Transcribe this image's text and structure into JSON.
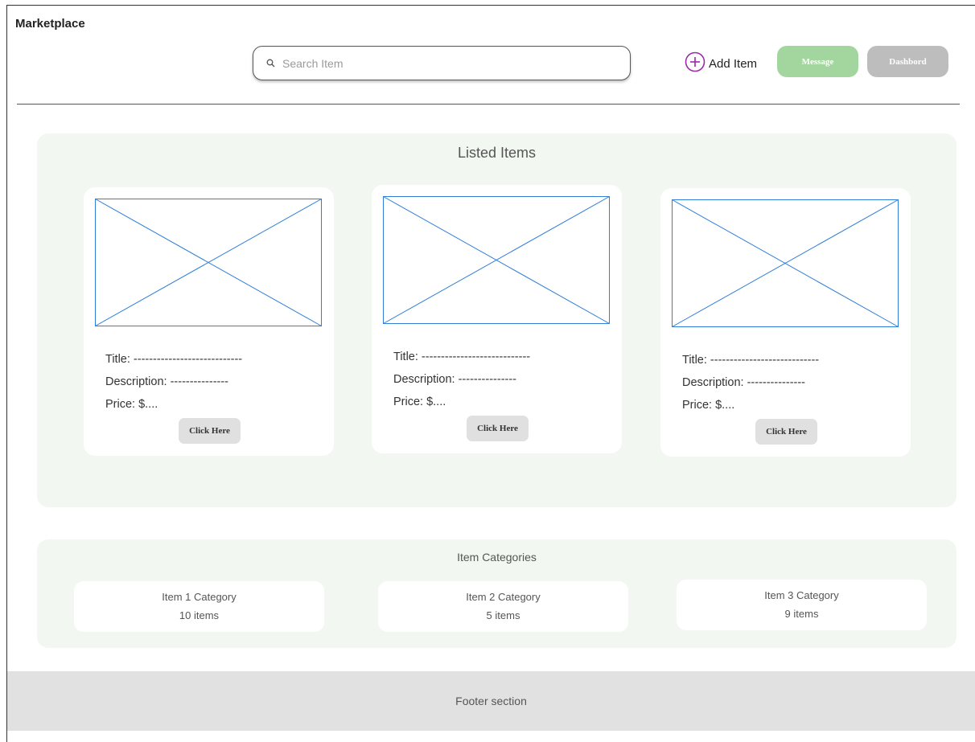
{
  "header": {
    "app_title": "Marketplace",
    "search_placeholder": "Search Item",
    "add_item_label": "Add Item",
    "message_label": "Message",
    "dashboard_label": "Dashbord"
  },
  "listed": {
    "title": "Listed Items",
    "cards": [
      {
        "title": "Title: ----------------------------",
        "description": "Description: ---------------",
        "price": "Price: $....",
        "button": "Click Here"
      },
      {
        "title": "Title: ----------------------------",
        "description": "Description: ---------------",
        "price": "Price: $....",
        "button": "Click Here"
      },
      {
        "title": "Title: ----------------------------",
        "description": "Description: ---------------",
        "price": "Price: $....",
        "button": "Click Here"
      }
    ]
  },
  "categories": {
    "title": "Item Categories",
    "items": [
      {
        "name": "Item 1 Category",
        "count": "10 items"
      },
      {
        "name": "Item 2 Category",
        "count": "5 items"
      },
      {
        "name": "Item 3 Category",
        "count": "9 items"
      }
    ]
  },
  "footer": {
    "label": "Footer section"
  },
  "colors": {
    "accent_green": "#a3d59e",
    "neutral_gray": "#bdbdbd",
    "section_bg": "#f2f8f1",
    "placeholder_blue": "#2f7ed8",
    "add_icon_purple": "#9b2aa8"
  },
  "icons": {
    "search": "search-icon",
    "add": "plus-circle-icon",
    "image_placeholder": "image-placeholder-icon"
  }
}
